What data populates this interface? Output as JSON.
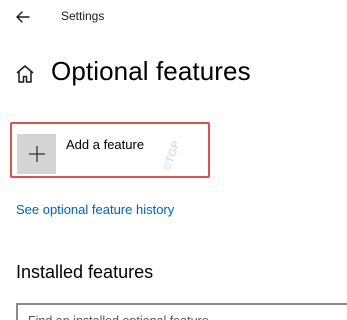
{
  "header": {
    "title": "Settings",
    "back_icon": "arrow-left-icon"
  },
  "page": {
    "title": "Optional features",
    "icon": "home-icon"
  },
  "add_feature": {
    "label": "Add a feature",
    "icon": "plus-icon"
  },
  "watermark": {
    "text": "©TGP"
  },
  "history_link": {
    "label": "See optional feature history"
  },
  "installed": {
    "heading": "Installed features",
    "search_placeholder": "Find an installed optional feature"
  },
  "colors": {
    "link": "#0063b1",
    "highlight": "#e0504f",
    "tile": "#d4d4d4"
  }
}
